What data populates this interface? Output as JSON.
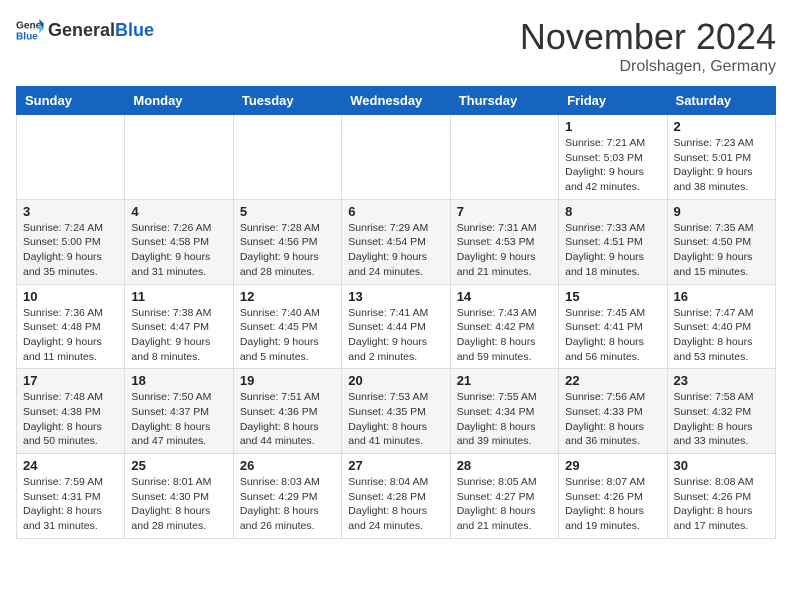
{
  "header": {
    "logo_general": "General",
    "logo_blue": "Blue",
    "title": "November 2024",
    "location": "Drolshagen, Germany"
  },
  "weekdays": [
    "Sunday",
    "Monday",
    "Tuesday",
    "Wednesday",
    "Thursday",
    "Friday",
    "Saturday"
  ],
  "weeks": [
    [
      {
        "day": "",
        "info": ""
      },
      {
        "day": "",
        "info": ""
      },
      {
        "day": "",
        "info": ""
      },
      {
        "day": "",
        "info": ""
      },
      {
        "day": "",
        "info": ""
      },
      {
        "day": "1",
        "info": "Sunrise: 7:21 AM\nSunset: 5:03 PM\nDaylight: 9 hours and 42 minutes."
      },
      {
        "day": "2",
        "info": "Sunrise: 7:23 AM\nSunset: 5:01 PM\nDaylight: 9 hours and 38 minutes."
      }
    ],
    [
      {
        "day": "3",
        "info": "Sunrise: 7:24 AM\nSunset: 5:00 PM\nDaylight: 9 hours and 35 minutes."
      },
      {
        "day": "4",
        "info": "Sunrise: 7:26 AM\nSunset: 4:58 PM\nDaylight: 9 hours and 31 minutes."
      },
      {
        "day": "5",
        "info": "Sunrise: 7:28 AM\nSunset: 4:56 PM\nDaylight: 9 hours and 28 minutes."
      },
      {
        "day": "6",
        "info": "Sunrise: 7:29 AM\nSunset: 4:54 PM\nDaylight: 9 hours and 24 minutes."
      },
      {
        "day": "7",
        "info": "Sunrise: 7:31 AM\nSunset: 4:53 PM\nDaylight: 9 hours and 21 minutes."
      },
      {
        "day": "8",
        "info": "Sunrise: 7:33 AM\nSunset: 4:51 PM\nDaylight: 9 hours and 18 minutes."
      },
      {
        "day": "9",
        "info": "Sunrise: 7:35 AM\nSunset: 4:50 PM\nDaylight: 9 hours and 15 minutes."
      }
    ],
    [
      {
        "day": "10",
        "info": "Sunrise: 7:36 AM\nSunset: 4:48 PM\nDaylight: 9 hours and 11 minutes."
      },
      {
        "day": "11",
        "info": "Sunrise: 7:38 AM\nSunset: 4:47 PM\nDaylight: 9 hours and 8 minutes."
      },
      {
        "day": "12",
        "info": "Sunrise: 7:40 AM\nSunset: 4:45 PM\nDaylight: 9 hours and 5 minutes."
      },
      {
        "day": "13",
        "info": "Sunrise: 7:41 AM\nSunset: 4:44 PM\nDaylight: 9 hours and 2 minutes."
      },
      {
        "day": "14",
        "info": "Sunrise: 7:43 AM\nSunset: 4:42 PM\nDaylight: 8 hours and 59 minutes."
      },
      {
        "day": "15",
        "info": "Sunrise: 7:45 AM\nSunset: 4:41 PM\nDaylight: 8 hours and 56 minutes."
      },
      {
        "day": "16",
        "info": "Sunrise: 7:47 AM\nSunset: 4:40 PM\nDaylight: 8 hours and 53 minutes."
      }
    ],
    [
      {
        "day": "17",
        "info": "Sunrise: 7:48 AM\nSunset: 4:38 PM\nDaylight: 8 hours and 50 minutes."
      },
      {
        "day": "18",
        "info": "Sunrise: 7:50 AM\nSunset: 4:37 PM\nDaylight: 8 hours and 47 minutes."
      },
      {
        "day": "19",
        "info": "Sunrise: 7:51 AM\nSunset: 4:36 PM\nDaylight: 8 hours and 44 minutes."
      },
      {
        "day": "20",
        "info": "Sunrise: 7:53 AM\nSunset: 4:35 PM\nDaylight: 8 hours and 41 minutes."
      },
      {
        "day": "21",
        "info": "Sunrise: 7:55 AM\nSunset: 4:34 PM\nDaylight: 8 hours and 39 minutes."
      },
      {
        "day": "22",
        "info": "Sunrise: 7:56 AM\nSunset: 4:33 PM\nDaylight: 8 hours and 36 minutes."
      },
      {
        "day": "23",
        "info": "Sunrise: 7:58 AM\nSunset: 4:32 PM\nDaylight: 8 hours and 33 minutes."
      }
    ],
    [
      {
        "day": "24",
        "info": "Sunrise: 7:59 AM\nSunset: 4:31 PM\nDaylight: 8 hours and 31 minutes."
      },
      {
        "day": "25",
        "info": "Sunrise: 8:01 AM\nSunset: 4:30 PM\nDaylight: 8 hours and 28 minutes."
      },
      {
        "day": "26",
        "info": "Sunrise: 8:03 AM\nSunset: 4:29 PM\nDaylight: 8 hours and 26 minutes."
      },
      {
        "day": "27",
        "info": "Sunrise: 8:04 AM\nSunset: 4:28 PM\nDaylight: 8 hours and 24 minutes."
      },
      {
        "day": "28",
        "info": "Sunrise: 8:05 AM\nSunset: 4:27 PM\nDaylight: 8 hours and 21 minutes."
      },
      {
        "day": "29",
        "info": "Sunrise: 8:07 AM\nSunset: 4:26 PM\nDaylight: 8 hours and 19 minutes."
      },
      {
        "day": "30",
        "info": "Sunrise: 8:08 AM\nSunset: 4:26 PM\nDaylight: 8 hours and 17 minutes."
      }
    ]
  ]
}
